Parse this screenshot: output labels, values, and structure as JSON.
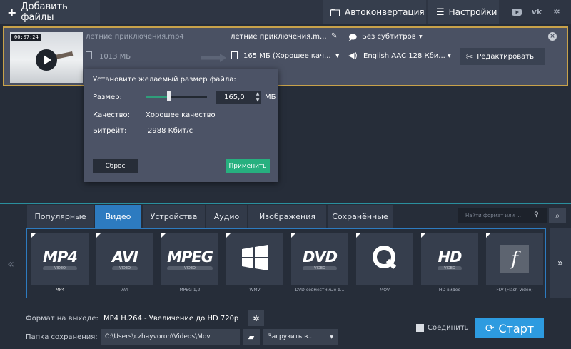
{
  "toolbar": {
    "add_files": "Добавить файлы",
    "autoconvert": "Автоконвертация",
    "settings": "Настройки",
    "social": [
      "▶",
      "vk",
      "⚙"
    ]
  },
  "file": {
    "thumb_time": "00:07:24",
    "src_name": "летние приключения.mp4",
    "src_size": "1013 МБ",
    "out_name": "летние приключения.m...",
    "out_size": "165 МБ (Хорошее кач...",
    "subtitles": "Без субтитров",
    "audio": "English AAC 128 Кби...",
    "edit_label": "Редактировать"
  },
  "popup": {
    "title": "Установите желаемый размер файла:",
    "size_label": "Размер:",
    "size_value": "165,0",
    "size_unit": "МБ",
    "size_fraction": 0.38,
    "quality_label": "Качество:",
    "quality_value": "Хорошее качество",
    "bitrate_label": "Битрейт:",
    "bitrate_value": "2988 Кбит/с",
    "reset": "Сброс",
    "apply": "Применить"
  },
  "tabs": [
    "Популярные",
    "Видео",
    "Устройства",
    "Аудио",
    "Изображения",
    "Сохранённые"
  ],
  "active_tab": 1,
  "search": {
    "placeholder": "Найти формат или ..."
  },
  "formats": [
    {
      "label": "MP4",
      "logo": "MP4",
      "sub": "VIDEO"
    },
    {
      "label": "AVI",
      "logo": "AVI",
      "sub": "VIDEO"
    },
    {
      "label": "MPEG-1,2",
      "logo": "MPEG",
      "sub": "VIDEO"
    },
    {
      "label": "WMV",
      "logo": "windows-logo",
      "sub": ""
    },
    {
      "label": "DVD-совместимые в...",
      "logo": "DVD",
      "sub": "VIDEO"
    },
    {
      "label": "MOV",
      "logo": "quicktime-logo",
      "sub": ""
    },
    {
      "label": "HD-видео",
      "logo": "HD",
      "sub": "VIDEO"
    },
    {
      "label": "FLV (Flash Video)",
      "logo": "flash-logo",
      "sub": ""
    }
  ],
  "bottom": {
    "format_label": "Формат на выходе:",
    "format_value": "MP4 H.264 - Увеличение до HD 720p",
    "folder_label": "Папка сохранения:",
    "folder_value": "C:\\Users\\r.zhayvoron\\Videos\\Mov",
    "upload": "Загрузить в...",
    "join": "Соединить",
    "start": "Старт"
  },
  "colors": {
    "accent": "#2d7bc0",
    "start": "#2d9be0",
    "apply": "#27b07f",
    "selection_border": "#c8a24a"
  }
}
